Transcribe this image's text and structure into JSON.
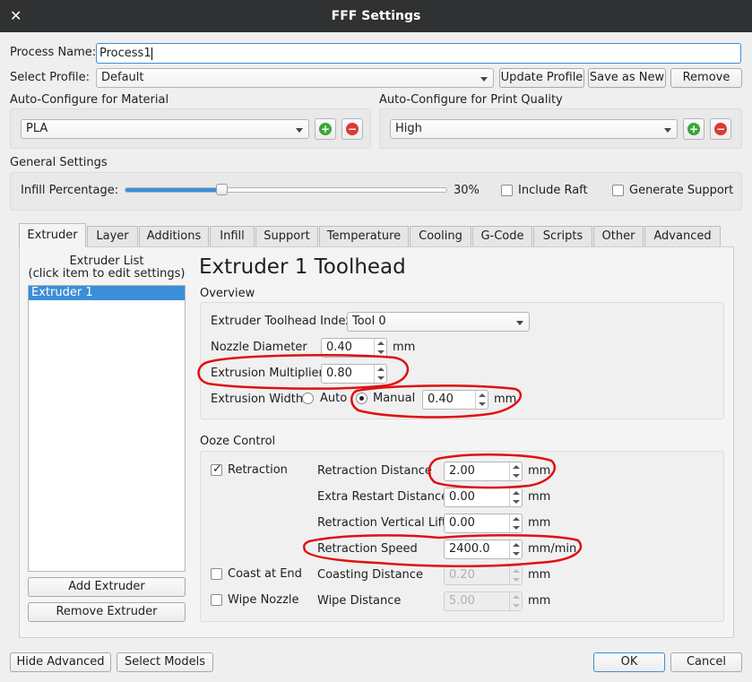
{
  "window": {
    "title": "FFF Settings",
    "close_glyph": "✕"
  },
  "process": {
    "name_label": "Process Name:",
    "name_value": "Process1",
    "profile_label": "Select Profile:",
    "profile_value": "Default",
    "update_button": "Update Profile",
    "save_new_button": "Save as New",
    "remove_button": "Remove"
  },
  "material": {
    "section_label": "Auto-Configure for Material",
    "value": "PLA"
  },
  "quality": {
    "section_label": "Auto-Configure for Print Quality",
    "value": "High"
  },
  "general": {
    "section_label": "General Settings",
    "infill_label": "Infill Percentage:",
    "infill_value": "30%",
    "infill_fraction": 0.3,
    "raft_label": "Include Raft",
    "support_label": "Generate Support"
  },
  "tabs": [
    {
      "label": "Extruder"
    },
    {
      "label": "Layer"
    },
    {
      "label": "Additions"
    },
    {
      "label": "Infill"
    },
    {
      "label": "Support"
    },
    {
      "label": "Temperature"
    },
    {
      "label": "Cooling"
    },
    {
      "label": "G-Code"
    },
    {
      "label": "Scripts"
    },
    {
      "label": "Other"
    },
    {
      "label": "Advanced"
    }
  ],
  "extruder_list": {
    "title_line1": "Extruder List",
    "title_line2": "(click item to edit settings)",
    "items": [
      {
        "label": "Extruder 1"
      }
    ],
    "add_button": "Add Extruder",
    "remove_button": "Remove Extruder"
  },
  "toolhead": {
    "title": "Extruder 1 Toolhead",
    "overview_label": "Overview",
    "index_label": "Extruder Toolhead Index",
    "index_value": "Tool 0",
    "nozzle_label": "Nozzle Diameter",
    "nozzle_value": "0.40",
    "nozzle_unit": "mm",
    "multiplier_label": "Extrusion Multiplier",
    "multiplier_value": "0.80",
    "width_label": "Extrusion Width",
    "width_auto": "Auto",
    "width_manual": "Manual",
    "width_value": "0.40",
    "width_unit": "mm"
  },
  "ooze": {
    "section_label": "Ooze Control",
    "retraction_label": "Retraction",
    "retraction_checked": "✓",
    "ret_distance_label": "Retraction Distance",
    "ret_distance_value": "2.00",
    "restart_label": "Extra Restart Distance",
    "restart_value": "0.00",
    "lift_label": "Retraction Vertical Lift",
    "lift_value": "0.00",
    "speed_label": "Retraction Speed",
    "speed_value": "2400.0",
    "speed_unit": "mm/min",
    "coast_label": "Coast at End",
    "coasting_label": "Coasting Distance",
    "coasting_value": "0.20",
    "wipe_label": "Wipe Nozzle",
    "wipe_distance_label": "Wipe Distance",
    "wipe_distance_value": "5.00",
    "unit_mm": "mm"
  },
  "footer": {
    "hide_advanced": "Hide Advanced",
    "select_models": "Select Models",
    "ok": "OK",
    "cancel": "Cancel"
  },
  "colors": {
    "accent": "#3b8ed8",
    "titlebar": "#2f3132",
    "annotation": "#e01010",
    "add_icon": "#3aa63a",
    "remove_icon": "#d93a3a"
  },
  "icons": [
    "close-icon",
    "add-icon",
    "remove-icon",
    "dropdown-arrow-icon",
    "check-icon"
  ]
}
